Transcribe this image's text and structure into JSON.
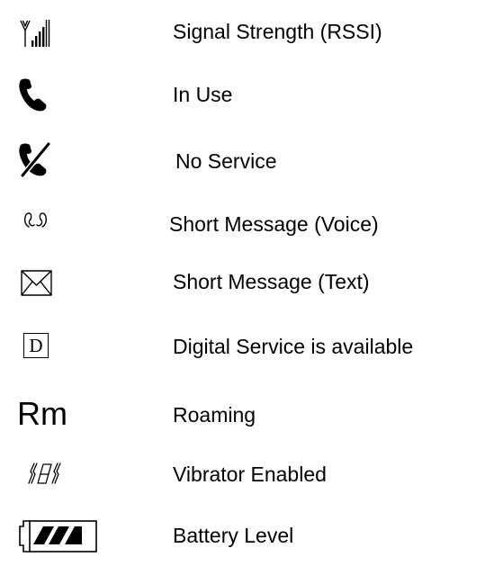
{
  "legend": {
    "items": [
      {
        "icon": "signal-strength-icon",
        "label": "Signal Strength (RSSI)"
      },
      {
        "icon": "in-use-phone-icon",
        "label": "In Use"
      },
      {
        "icon": "no-service-phone-icon",
        "label": "No Service"
      },
      {
        "icon": "voicemail-icon",
        "label": "Short Message (Voice)"
      },
      {
        "icon": "envelope-icon",
        "label": "Short Message (Text)"
      },
      {
        "icon": "digital-service-icon",
        "icon_text": "D",
        "label": "Digital Service is available"
      },
      {
        "icon": "roaming-icon",
        "icon_text": "Rm",
        "label": "Roaming"
      },
      {
        "icon": "vibrator-icon",
        "label": "Vibrator Enabled"
      },
      {
        "icon": "battery-icon",
        "label": "Battery Level"
      }
    ]
  }
}
